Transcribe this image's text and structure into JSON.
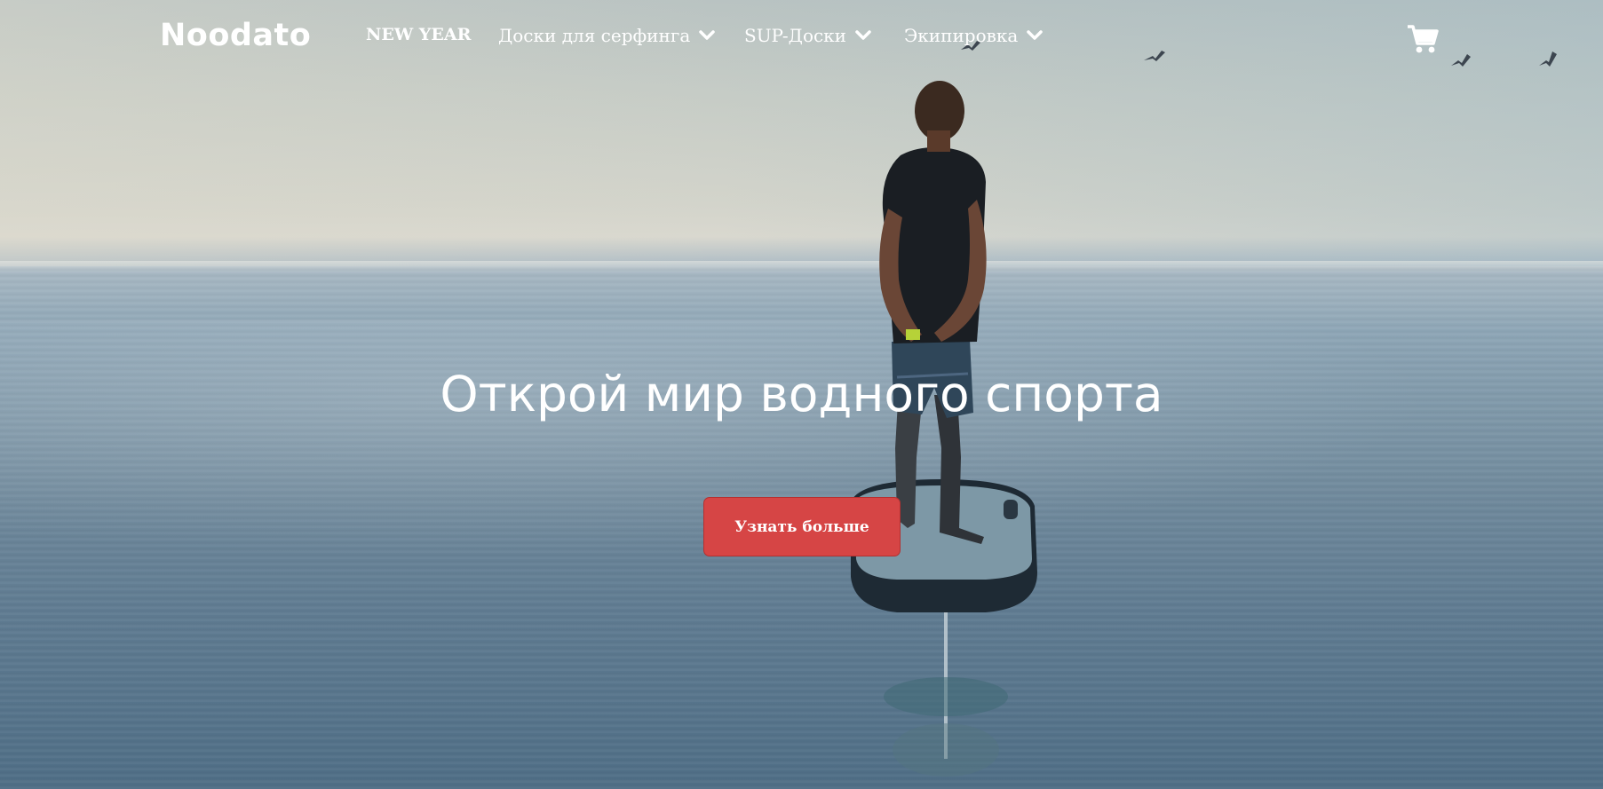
{
  "brand": {
    "logo": "Noodato"
  },
  "nav": {
    "items": [
      {
        "label": "NEW YEAR",
        "has_dropdown": false
      },
      {
        "label": "Доски для серфинга",
        "has_dropdown": true
      },
      {
        "label": "SUP-Доски",
        "has_dropdown": true
      },
      {
        "label": "Экипировка",
        "has_dropdown": true
      }
    ],
    "cart_icon": "shopping-cart-icon"
  },
  "hero": {
    "headline": "Открой мир водного спорта",
    "cta_label": "Узнать больше",
    "cta_color": "#d64545",
    "background": "person standing on hydrofoil board over calm sea"
  }
}
